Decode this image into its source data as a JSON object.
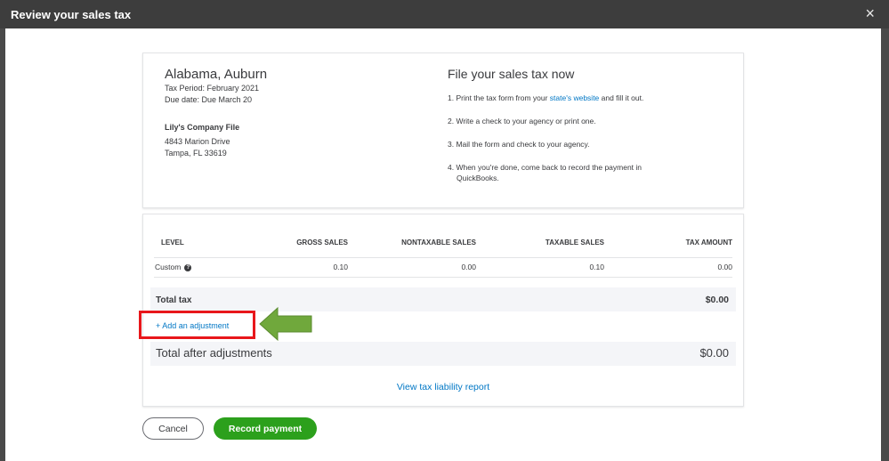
{
  "dialog": {
    "title": "Review your sales tax",
    "close_icon": "×"
  },
  "agency": {
    "location": "Alabama, Auburn",
    "tax_period": "Tax Period: February 2021",
    "due_date": "Due date:  Due March 20",
    "company": "Lily's Company File",
    "address1": "4843 Marion Drive",
    "address2": "Tampa, FL 33619"
  },
  "instructions": {
    "heading": "File your sales tax now",
    "step1_pre": "1. Print the tax form from your ",
    "step1_link": "state's website",
    "step1_post": " and fill it out.",
    "step2": "2. Write a check to your agency or print one.",
    "step3": "3. Mail the form and check to your agency.",
    "step4_line1": "4. When you're done, come back to record the payment in",
    "step4_line2": "QuickBooks."
  },
  "table": {
    "headers": {
      "level": "LEVEL",
      "gross": "GROSS SALES",
      "nontaxable": "NONTAXABLE SALES",
      "taxable": "TAXABLE SALES",
      "tax_amount": "TAX AMOUNT"
    },
    "rows": [
      {
        "level": "Custom",
        "gross": "0.10",
        "nontaxable": "0.00",
        "taxable": "0.10",
        "tax_amount": "0.00"
      }
    ]
  },
  "totals": {
    "total_tax_label": "Total tax",
    "total_tax_value": "$0.00",
    "add_adjustment": "+ Add an adjustment",
    "after_label": "Total after adjustments",
    "after_value": "$0.00"
  },
  "report_link": "View tax liability report",
  "buttons": {
    "cancel": "Cancel",
    "record": "Record payment"
  },
  "colors": {
    "titlebar": "#3d3d3d",
    "link": "#0077c5",
    "primary": "#2ca01c",
    "highlight": "#e8171b",
    "arrow": "#70a83c"
  }
}
